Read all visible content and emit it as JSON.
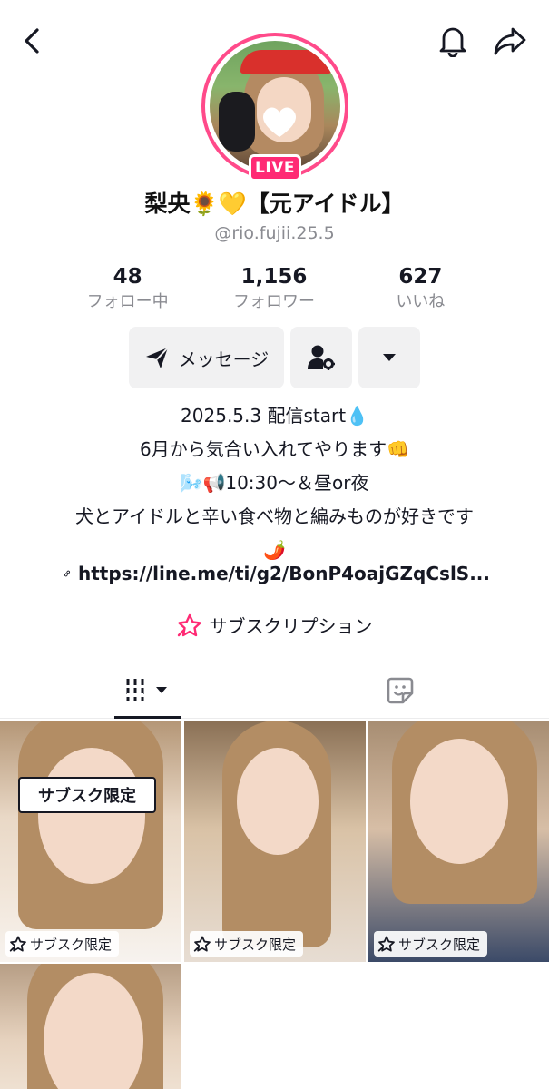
{
  "colors": {
    "accent": "#ff2a74",
    "text": "#161823",
    "muted": "#8a8b91",
    "button_bg": "#f1f1f2"
  },
  "header": {
    "back_icon": "chevron-left-icon",
    "bell_icon": "bell-icon",
    "share_icon": "share-arrow-icon"
  },
  "profile": {
    "live_badge": "LIVE",
    "display_name": "梨央🌻💛【元アイドル】",
    "handle": "@rio.fujii.25.5"
  },
  "stats": [
    {
      "value": "48",
      "label": "フォロー中"
    },
    {
      "value": "1,156",
      "label": "フォロワー"
    },
    {
      "value": "627",
      "label": "いいね"
    }
  ],
  "actions": {
    "message_label": "メッセージ",
    "message_icon": "send-icon",
    "add_user_icon": "user-settings-icon",
    "more_icon": "caret-down-icon"
  },
  "bio": {
    "lines": [
      "2025.5.3 配信start💧",
      "6月から気合い入れてやります👊",
      "🌬️📢10:30〜＆昼or夜",
      "犬とアイドルと辛い食べ物と編みものが好きです",
      "🌶️"
    ],
    "link": "https://line.me/ti/g2/BonP4oajGZqCslS...",
    "subscription_label": "サブスクリプション"
  },
  "tabs": {
    "videos_icon": "grid-bars-icon",
    "liked_icon": "sticker-icon"
  },
  "videos": [
    {
      "tag": "サブスク限定",
      "overlay": "サブスク限定"
    },
    {
      "tag": "サブスク限定"
    },
    {
      "tag": "サブスク限定"
    },
    {}
  ]
}
